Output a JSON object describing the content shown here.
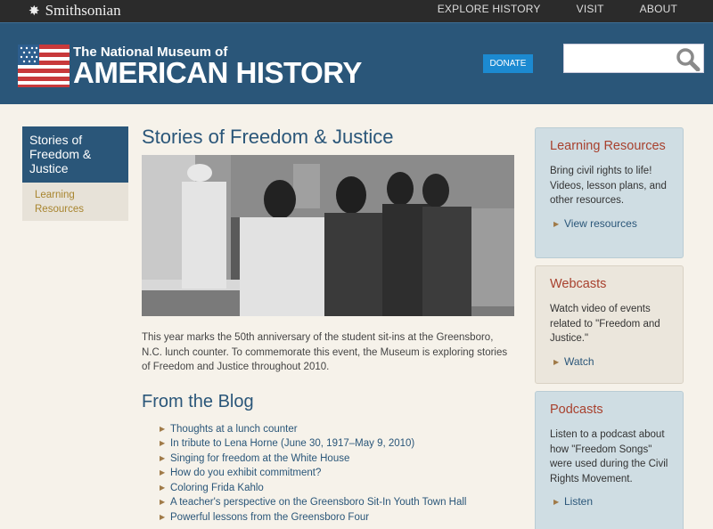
{
  "topbar": {
    "brand": "Smithsonian",
    "nav": [
      "EXPLORE HISTORY",
      "VISIT",
      "ABOUT"
    ]
  },
  "header": {
    "title_small": "The National Museum of",
    "title_big": "AMERICAN HISTORY",
    "donate_label": "DONATE",
    "search_placeholder": ""
  },
  "leftnav": {
    "current": "Stories of Freedom & Justice",
    "items": [
      "Learning Resources"
    ]
  },
  "main": {
    "title": "Stories of Freedom & Justice",
    "intro": "This year marks the 50th anniversary of the student sit-ins at the Greensboro, N.C. lunch counter. To commemorate this event, the Museum is exploring stories of Freedom and Justice throughout 2010.",
    "blog_title": "From the Blog",
    "blog_posts": [
      "Thoughts at a lunch counter",
      "In tribute to Lena Horne (June 30, 1917–May 9, 2010)",
      "Singing for freedom at the White House",
      "How do you exhibit commitment?",
      "Coloring Frida Kahlo",
      "A teacher's perspective on the Greensboro Sit-In Youth Town Hall",
      "Powerful lessons from the Greensboro Four"
    ]
  },
  "sidebar": [
    {
      "title": "Learning Resources",
      "text": "Bring civil rights to life! Videos, lesson plans, and other resources.",
      "link": "View resources"
    },
    {
      "title": "Webcasts",
      "text": "Watch video of events related to \"Freedom and Justice.\"",
      "link": "Watch"
    },
    {
      "title": "Podcasts",
      "text": "Listen to a podcast about how \"Freedom Songs\" were used during the Civil Rights Movement.",
      "link": "Listen"
    }
  ],
  "colors": {
    "header_bg": "#2a5679",
    "topbar_bg": "#2b2b2b",
    "accent_link": "#2a5679",
    "sidebar_title": "#a8412e",
    "donate_bg": "#1c8ad1"
  }
}
